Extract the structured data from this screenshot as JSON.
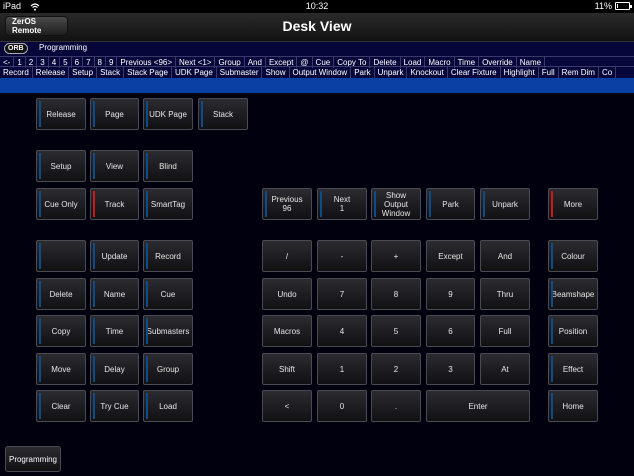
{
  "status_bar": {
    "device": "iPad",
    "time": "10:32",
    "battery": "11%"
  },
  "nav": {
    "back_label": "ZerOS Remote",
    "title": "Desk View"
  },
  "command": {
    "logo": "ORB",
    "mode_label": "Programming",
    "row1": [
      "<-",
      "1",
      "2",
      "3",
      "4",
      "5",
      "6",
      "7",
      "8",
      "9",
      "Previous <96>",
      "Next <1>",
      "Group",
      "And",
      "Except",
      "@",
      "Cue",
      "Copy To",
      "Delete",
      "Load",
      "Macro",
      "Time",
      "Override",
      "Name"
    ],
    "row2": [
      "Record",
      "Release",
      "Setup",
      "Stack",
      "Stack Page",
      "UDK Page",
      "Submaster",
      "Show",
      "Output Window",
      "Park",
      "Unpark",
      "Knockout",
      "Clear Fixture",
      "Highlight",
      "Full",
      "Rem Dim",
      "Co"
    ]
  },
  "keys": {
    "release": "Release",
    "page": "Page",
    "udk_page": "UDK Page",
    "stack": "Stack",
    "setup": "Setup",
    "view": "View",
    "blind": "Blind",
    "cue_only": "Cue Only",
    "track": "Track",
    "smarttag": "SmartTag",
    "previous": "Previous\n96",
    "next": "Next\n1",
    "show_output_window": "Show\nOutput\nWindow",
    "park": "Park",
    "unpark": "Unpark",
    "more": "More",
    "blank": "",
    "update": "Update",
    "record": "Record",
    "slash": "/",
    "minus": "-",
    "plus": "+",
    "except": "Except",
    "and": "And",
    "colour": "Colour",
    "delete": "Delete",
    "name": "Name",
    "cue": "Cue",
    "undo": "Undo",
    "seven": "7",
    "eight": "8",
    "nine": "9",
    "thru": "Thru",
    "beamshape": "Beamshape",
    "copy": "Copy",
    "time": "Time",
    "submasters": "Submasters",
    "macros": "Macros",
    "four": "4",
    "five": "5",
    "six": "6",
    "full": "Full",
    "position": "Position",
    "move": "Move",
    "delay": "Delay",
    "group": "Group",
    "shift": "Shift",
    "one": "1",
    "two": "2",
    "three": "3",
    "at": "At",
    "effect": "Effect",
    "clear": "Clear",
    "try_cue": "Try Cue",
    "load": "Load",
    "less_than": "<",
    "zero": "0",
    "dot": ".",
    "enter": "Enter",
    "home": "Home"
  },
  "bottom": {
    "programming_label": "Programming"
  }
}
